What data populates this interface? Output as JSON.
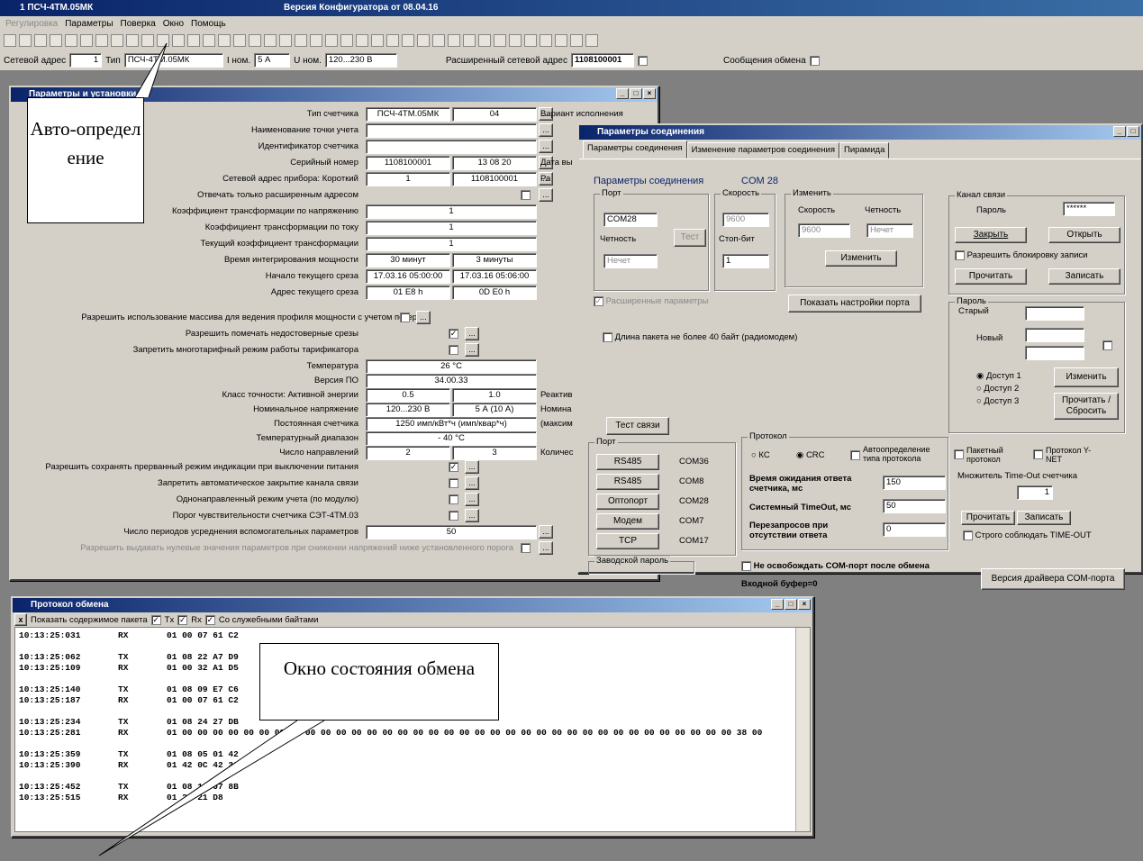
{
  "app": {
    "title": "1 ПСЧ-4ТМ.05МК",
    "version": "Версия Конфигуратора  от 08.04.16"
  },
  "menu": [
    "Регулировка",
    "Параметры",
    "Поверка",
    "Окно",
    "Помощь"
  ],
  "addrbar": {
    "net_label": "Сетевой адрес",
    "net_value": "1",
    "type_label": "Тип",
    "type_value": "ПСЧ-4ТМ.05МК",
    "inom_label": "I ном.",
    "inom_value": "5 А",
    "unom_label": "U ном.",
    "unom_value": "120...230 В",
    "ext_label": "Расширенный сетевой адрес",
    "ext_value": "1108100001",
    "msg_label": "Сообщения обмена"
  },
  "params": {
    "title": "Параметры и установки",
    "rows": [
      {
        "label": "Тип счетчика",
        "v1": "ПСЧ-4ТМ.05МК",
        "v2": "04",
        "extra": "Вариант исполнения"
      },
      {
        "label": "Наименование точки учета",
        "v1": "",
        "v2": ""
      },
      {
        "label": "Идентификатор счетчика",
        "v1": "",
        "v2": ""
      },
      {
        "label": "Серийный номер",
        "v1": "1108100001",
        "v2": "13 08 20",
        "extra": "Дата вы"
      },
      {
        "label": "Сетевой адрес прибора: Короткий",
        "v1": "1",
        "v2": "1108100001",
        "extra": "Ра"
      },
      {
        "label": "Отвечать только расширенным адресом",
        "v1": "",
        "v2": ""
      },
      {
        "label": "Коэффициент трансформации по напряжению",
        "v1": "1",
        "v2": ""
      },
      {
        "label": "Коэффициент трансформации по току",
        "v1": "1",
        "v2": ""
      },
      {
        "label": "Текущий коэффициент трансформации",
        "v1": "1",
        "v2": ""
      },
      {
        "label": "Время интегрирования мощности",
        "v1": "30 минут",
        "v2": "3 минуты"
      },
      {
        "label": "Начало текущего среза",
        "v1": "17.03.16 05:00:00",
        "v2": "17.03.16 05:06:00"
      },
      {
        "label": "Адрес текущего среза",
        "v1": "01 E8 h",
        "v2": "0D E0 h"
      }
    ],
    "chk_rows": [
      {
        "label": "Разрешить использование массива для ведения профиля мощности с учетом потерь"
      },
      {
        "label": "Разрешить помечать недостоверные срезы"
      },
      {
        "label": "Запретить многотарифный режим работы тарификатора"
      }
    ],
    "rows2": [
      {
        "label": "Температура",
        "v1": "26 °С"
      },
      {
        "label": "Версия ПО",
        "v1": "34.00.33"
      },
      {
        "label": "Класс точности: Активной энергии",
        "v1": "0.5",
        "v2": "1.0",
        "extra": "Реактив"
      },
      {
        "label": "Номинальное напряжение",
        "v1": "120...230 В",
        "v2": "5 А (10 А)",
        "extra": "Номина"
      },
      {
        "label": "Постоянная счетчика",
        "v1": "1250 имп/кВт*ч (имп/квар*ч)",
        "extra": "(максим"
      },
      {
        "label": "Температурный диапазон",
        "v1": "- 40 °С"
      },
      {
        "label": "Число направлений",
        "v1": "2",
        "v2": "3",
        "extra": "Количес"
      }
    ],
    "chk_rows2": [
      {
        "label": "Разрешить сохранять прерванный режим индикации при выключении питания"
      },
      {
        "label": "Запретить автоматическое закрытие канала связи"
      },
      {
        "label": "Однонаправленный режим учета (по модулю)"
      },
      {
        "label": "Порог чувствительности счетчика СЭТ-4ТМ.03"
      }
    ],
    "avg_label": "Число периодов усреднения вспомогательных параметров",
    "avg_value": "50",
    "zero_label": "Разрешить выдавать нулевые значения параметров при снижении напряжений ниже установленного порога"
  },
  "conn": {
    "title": "Параметры соединения",
    "tabs": [
      "Параметры соединения",
      "Изменение параметров соединения",
      "Пирамида"
    ],
    "header": "Параметры соединения",
    "com": "COM 28",
    "port_label": "Порт",
    "port": "COM28",
    "test_btn": "Тест",
    "speed_label": "Скорость",
    "speed": "9600",
    "parity_label": "Четность",
    "parity": "Нечет",
    "stop_label": "Стоп-бит",
    "stop": "1",
    "change_label": "Изменить",
    "ch_speed_label": "Скорость",
    "ch_speed": "9600",
    "ch_parity_label": "Четность",
    "ch_parity": "Нечет",
    "change_btn": "Изменить",
    "ext_params": "Расширенные параметры",
    "show_btn": "Показать настройки порта",
    "packet40": "Длина пакета не более 40 байт (радиомодем)",
    "channel": {
      "title": "Канал связи",
      "pwd_label": "Пароль",
      "pwd": "******",
      "close": "Закрыть",
      "open": "Открыть",
      "lock": "Разрешить блокировку записи",
      "read": "Прочитать",
      "write": "Записать"
    },
    "password": {
      "title": "Пароль",
      "old": "Старый",
      "new": "Новый",
      "a1": "Доступ 1",
      "a2": "Доступ 2",
      "a3": "Доступ 3",
      "change": "Изменить",
      "readreset": "Прочитать / Сбросить"
    },
    "test_link": "Тест связи",
    "ports_title": "Порт",
    "ports": [
      {
        "btn": "RS485",
        "com": "COM36"
      },
      {
        "btn": "RS485",
        "com": "COM8"
      },
      {
        "btn": "Оптопорт",
        "com": "COM28"
      },
      {
        "btn": "Модем",
        "com": "COM7"
      },
      {
        "btn": "TCP",
        "com": "COM17"
      }
    ],
    "factory_pwd": "Заводской пароль",
    "protocol": {
      "title": "Протокол",
      "kc": "КС",
      "crc": "CRC",
      "auto": "Автоопределение типа протокола",
      "wait_label": "Время ожидания ответа счетчика, мс",
      "wait": "150",
      "sys_label": "Системный TimeOut, мс",
      "sys": "50",
      "retry_label": "Перезапросов при отсутствии ответа",
      "retry": "0",
      "packet": "Пакетный протокол",
      "ynet": "Протокол Y-NET",
      "mult_label": "Множитель Time-Out счетчика",
      "mult": "1",
      "read": "Прочитать",
      "write": "Записать",
      "strict": "Строго соблюдать TIME-OUT"
    },
    "no_release": "Не освобождать COM-порт после обмена",
    "in_buf": "Входной буфер=0",
    "driver_btn": "Версия драйвера COM-порта"
  },
  "log": {
    "title": "Протокол обмена",
    "show": "Показать содержимое пакета",
    "tx": "Tx",
    "rx": "Rx",
    "svc": "Со служебными байтами",
    "rows": [
      [
        "10:13:25:031",
        "RX",
        "01 00 07 61 C2"
      ],
      [
        "",
        "",
        " "
      ],
      [
        "10:13:25:062",
        "TX",
        "01 08 22 A7 D9"
      ],
      [
        "10:13:25:109",
        "RX",
        "01 00 32 A1 D5"
      ],
      [
        "",
        "",
        " "
      ],
      [
        "10:13:25:140",
        "TX",
        "01 08 09 E7 C6"
      ],
      [
        "10:13:25:187",
        "RX",
        "01 00 07 61 C2"
      ],
      [
        "",
        "",
        " "
      ],
      [
        "10:13:25:234",
        "TX",
        "01 08 24 27 DB"
      ],
      [
        "10:13:25:281",
        "RX",
        "01 00 00 00 00 00 00 00 00 00 00 00 00 00 00 00 00 00 00 00 00 00 00 00 00 00 00 00 00 00 00 00 00 00 00 00 00 38 00"
      ],
      [
        "",
        "",
        " "
      ],
      [
        "10:13:25:359",
        "TX",
        "01 08 05 01 42"
      ],
      [
        "10:13:25:390",
        "RX",
        "01 42 0C 42 33"
      ],
      [
        "",
        "",
        " "
      ],
      [
        "10:13:25:452",
        "TX",
        "01 08 12 07 8B"
      ],
      [
        "10:13:25:515",
        "RX",
        "01 20 21 D8"
      ]
    ]
  },
  "callouts": {
    "auto": "Авто-определение",
    "state": "Окно состояния обмена"
  }
}
